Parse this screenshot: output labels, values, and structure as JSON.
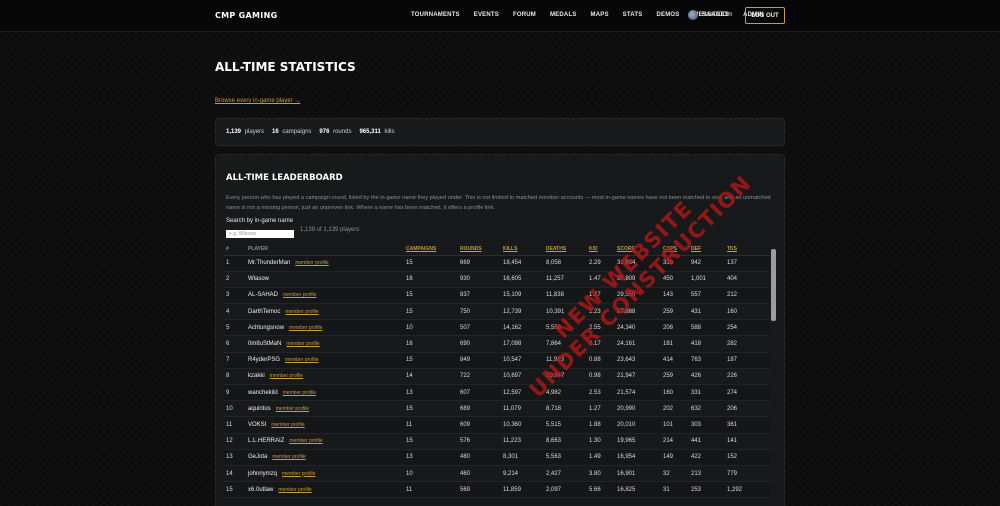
{
  "header": {
    "brand": "CMP GAMING",
    "nav": [
      "TOURNAMENTS",
      "EVENTS",
      "FORUM",
      "MEDALS",
      "MAPS",
      "STATS",
      "DEMOS",
      "MESSAGES",
      "ADMIN"
    ],
    "user_name": "RAnDOOm",
    "logout_label": "LOG OUT"
  },
  "page": {
    "title": "ALL-TIME STATISTICS",
    "browse_link": "Browse every in-game player →"
  },
  "summary": {
    "players_value": "1,139",
    "players_label": "players",
    "campaigns_value": "16",
    "campaigns_label": "campaigns",
    "rounds_value": "976",
    "rounds_label": "rounds",
    "kills_value": "965,311",
    "kills_label": "kills"
  },
  "leaderboard": {
    "title": "ALL-TIME LEADERBOARD",
    "description": "Every person who has played a campaign round, listed by the in-game name they played under. This is not limited to matched member accounts — most in-game names have not been matched to one, and an unmatched name is not a missing person, just an unproven link. Where a name has been matched, it offers a profile link.",
    "search_label": "Search by in-game name",
    "search_placeholder": "e.g. Wlasow",
    "count_text": "1,139 of 1,139 players",
    "columns": [
      "#",
      "PLAYER",
      "CAMPAIGNS",
      "ROUNDS",
      "KILLS",
      "DEATHS",
      "K/D",
      "SCORE",
      "CAPS",
      "DEF",
      "TKS"
    ],
    "profile_link_label": "member profile",
    "rows": [
      {
        "rank": "1",
        "player": "Mr.ThunderMan",
        "linked": true,
        "campaigns": "15",
        "rounds": "669",
        "kills": "18,454",
        "deaths": "8,058",
        "kd": "2.29",
        "score": "31,984",
        "caps": "339",
        "def": "942",
        "tks": "137"
      },
      {
        "rank": "2",
        "player": "Wlasow",
        "linked": false,
        "campaigns": "16",
        "rounds": "930",
        "kills": "16,605",
        "deaths": "11,257",
        "kd": "1.47",
        "score": "30,809",
        "caps": "450",
        "def": "1,001",
        "tks": "404"
      },
      {
        "rank": "3",
        "player": "AL-SAHAD",
        "linked": true,
        "campaigns": "15",
        "rounds": "837",
        "kills": "15,109",
        "deaths": "11,838",
        "kd": "1.27",
        "score": "29,550",
        "caps": "143",
        "def": "557",
        "tks": "212"
      },
      {
        "rank": "4",
        "player": "DarthTemoc",
        "linked": true,
        "campaigns": "15",
        "rounds": "750",
        "kills": "12,739",
        "deaths": "10,391",
        "kd": "1.23",
        "score": "27,888",
        "caps": "259",
        "def": "431",
        "tks": "160"
      },
      {
        "rank": "5",
        "player": "Achtungsnow",
        "linked": true,
        "campaigns": "10",
        "rounds": "507",
        "kills": "14,162",
        "deaths": "5,558",
        "kd": "2.55",
        "score": "24,340",
        "caps": "208",
        "def": "588",
        "tks": "254"
      },
      {
        "rank": "6",
        "player": "0m8uStMaN",
        "linked": true,
        "campaigns": "16",
        "rounds": "690",
        "kills": "17,098",
        "deaths": "7,864",
        "kd": "2.17",
        "score": "24,161",
        "caps": "181",
        "def": "418",
        "tks": "282"
      },
      {
        "rank": "7",
        "player": "R4yderPSG",
        "linked": true,
        "campaigns": "15",
        "rounds": "849",
        "kills": "10,547",
        "deaths": "11,903",
        "kd": "0.88",
        "score": "23,643",
        "caps": "414",
        "def": "763",
        "tks": "187"
      },
      {
        "rank": "8",
        "player": "kzakki",
        "linked": true,
        "campaigns": "14",
        "rounds": "722",
        "kills": "10,697",
        "deaths": "10,947",
        "kd": "0.98",
        "score": "21,947",
        "caps": "259",
        "def": "426",
        "tks": "226"
      },
      {
        "rank": "9",
        "player": "wanchekild",
        "linked": true,
        "campaigns": "13",
        "rounds": "607",
        "kills": "12,597",
        "deaths": "4,982",
        "kd": "2.53",
        "score": "21,574",
        "caps": "160",
        "def": "331",
        "tks": "274"
      },
      {
        "rank": "10",
        "player": "aquintus",
        "linked": true,
        "campaigns": "15",
        "rounds": "689",
        "kills": "11,079",
        "deaths": "8,718",
        "kd": "1.27",
        "score": "20,990",
        "caps": "202",
        "def": "632",
        "tks": "206"
      },
      {
        "rank": "11",
        "player": "VOKSI",
        "linked": true,
        "campaigns": "11",
        "rounds": "609",
        "kills": "10,360",
        "deaths": "5,515",
        "kd": "1.88",
        "score": "20,010",
        "caps": "101",
        "def": "303",
        "tks": "361"
      },
      {
        "rank": "12",
        "player": "L.L.HERRAIZ",
        "linked": true,
        "campaigns": "15",
        "rounds": "576",
        "kills": "11,223",
        "deaths": "8,663",
        "kd": "1.30",
        "score": "19,965",
        "caps": "214",
        "def": "441",
        "tks": "141"
      },
      {
        "rank": "13",
        "player": "GeJota",
        "linked": true,
        "campaigns": "13",
        "rounds": "480",
        "kills": "8,301",
        "deaths": "5,563",
        "kd": "1.49",
        "score": "16,954",
        "caps": "149",
        "def": "422",
        "tks": "152"
      },
      {
        "rank": "14",
        "player": "johnnymzq",
        "linked": true,
        "campaigns": "10",
        "rounds": "460",
        "kills": "9,214",
        "deaths": "2,427",
        "kd": "3.80",
        "score": "16,901",
        "caps": "32",
        "def": "213",
        "tks": "779"
      },
      {
        "rank": "15",
        "player": "x6.0utlaw",
        "linked": true,
        "campaigns": "11",
        "rounds": "569",
        "kills": "11,859",
        "deaths": "2,097",
        "kd": "5.66",
        "score": "16,825",
        "caps": "31",
        "def": "253",
        "tks": "1,292"
      }
    ]
  },
  "watermark": {
    "line1": "NEW WEBSITE",
    "line2": "UNDER CONSTRUCTION",
    "color": "#b01a1a"
  },
  "colors": {
    "accent": "#c89b3c",
    "background": "#0b0c0b",
    "panel": "#17191a"
  }
}
